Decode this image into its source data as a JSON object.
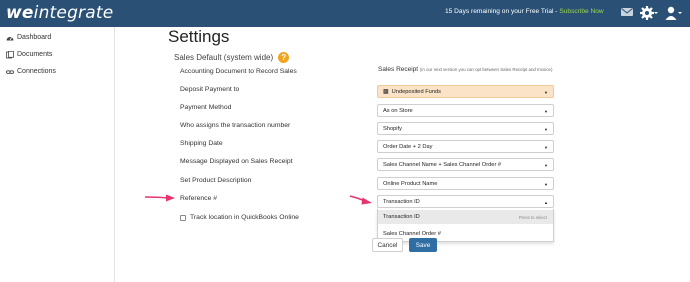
{
  "header": {
    "logo_we": "we",
    "logo_rest": "integrate",
    "trial_text": "15 Days remaining on your Free Trial - ",
    "subscribe_label": "Subscribe Now",
    "icons": [
      "mail-icon",
      "gear-icon",
      "user-icon"
    ]
  },
  "sidebar": {
    "items": [
      {
        "label": "Dashboard",
        "icon": "dashboard-icon"
      },
      {
        "label": "Documents",
        "icon": "documents-icon"
      },
      {
        "label": "Connections",
        "icon": "connections-icon"
      }
    ]
  },
  "page": {
    "title": "Settings",
    "section_title": "Sales Default (system wide)",
    "help_label": "?"
  },
  "form": {
    "labels": [
      "Accounting Document to Record Sales",
      "Deposit Payment to",
      "Payment Method",
      "Who assigns the transaction number",
      "Shipping Date",
      "Message Displayed on Sales Receipt",
      "Set Product Description",
      "Reference #"
    ],
    "sales_receipt_label": "Sales Receipt",
    "sales_receipt_note": "(in our next version you can opt between Sales Receipt and Invoice)",
    "selects": [
      {
        "value": "Undeposited Funds",
        "highlight": true
      },
      {
        "value": "As on Store"
      },
      {
        "value": "Shopify"
      },
      {
        "value": "Order Date + 2 Day"
      },
      {
        "value": "Sales Channel Name + Sales Channel Order #"
      },
      {
        "value": "Online Product Name"
      },
      {
        "value": "Transaction ID",
        "open": true
      }
    ],
    "reference_options": [
      {
        "label": "Transaction ID",
        "hint": "Press to select",
        "highlighted": true
      },
      {
        "label": "Sales Channel Order #"
      }
    ],
    "track_location_label": "Track location in QuickBooks Online",
    "track_location_checked": false,
    "cancel_label": "Cancel",
    "save_label": "Save"
  },
  "colors": {
    "topbar": "#2a5175",
    "subscribe": "#9bd64f",
    "help": "#f0a51e",
    "arrow": "#e8336f",
    "save": "#2f6da3",
    "highlight_select": "#fbe3c7"
  }
}
